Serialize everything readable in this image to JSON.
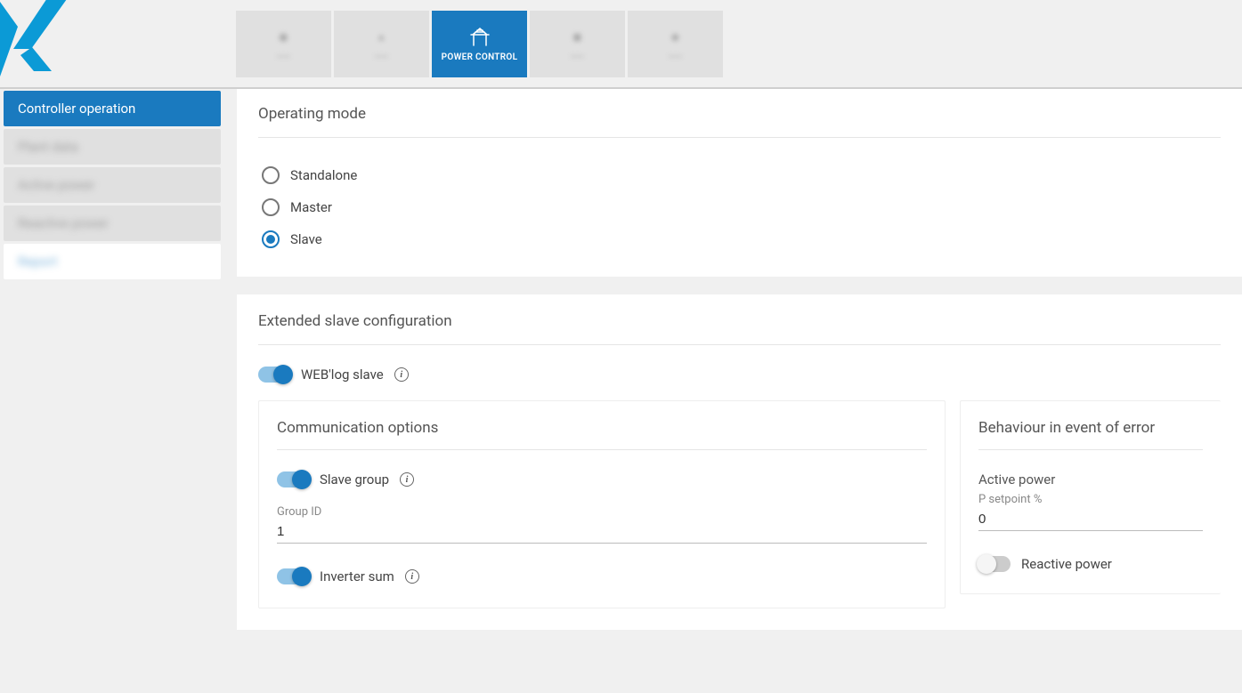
{
  "tabs": {
    "t0": {
      "label": "——"
    },
    "t1": {
      "label": "——"
    },
    "t2": {
      "label": "POWER CONTROL"
    },
    "t3": {
      "label": "——"
    },
    "t4": {
      "label": "——"
    }
  },
  "sidebar": {
    "s0": {
      "label": "Controller operation"
    },
    "s1": {
      "label": "Plant data"
    },
    "s2": {
      "label": "Active power"
    },
    "s3": {
      "label": "Reactive power"
    },
    "s4": {
      "label": "Report"
    }
  },
  "panel_operating_mode": {
    "title": "Operating mode",
    "options": {
      "standalone": "Standalone",
      "master": "Master",
      "slave": "Slave"
    },
    "selected": "slave"
  },
  "panel_extended": {
    "title": "Extended slave configuration",
    "weblog_slave_label": "WEB'log slave",
    "weblog_slave_on": true,
    "comm": {
      "title": "Communication options",
      "slave_group_label": "Slave group",
      "slave_group_on": true,
      "group_id_label": "Group ID",
      "group_id_value": "1",
      "inverter_sum_label": "Inverter sum",
      "inverter_sum_on": true
    },
    "behaviour": {
      "title": "Behaviour in event of error",
      "active_power_heading": "Active power",
      "p_setpoint_label": "P setpoint %",
      "p_setpoint_value": "0",
      "reactive_power_label": "Reactive power",
      "reactive_power_on": false
    }
  }
}
